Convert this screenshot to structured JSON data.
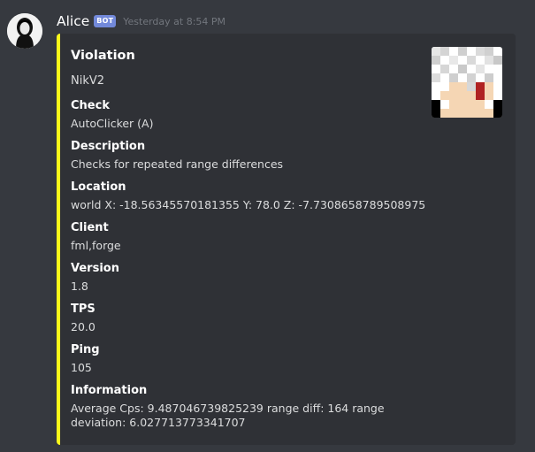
{
  "message": {
    "author": "Alice",
    "bot_tag": "BOT",
    "timestamp": "Yesterday at 8:54 PM",
    "avatar_icon": "user-avatar",
    "embed": {
      "accent_color": "#fbf81a",
      "title": "Violation",
      "description": "NikV2",
      "thumbnail_icon": "player-skin-head-thumbnail",
      "fields": [
        {
          "name": "Check",
          "value": "AutoClicker (A)"
        },
        {
          "name": "Description",
          "value": "Checks for repeated range differences"
        },
        {
          "name": "Location",
          "value": "world X: -18.56345570181355 Y: 78.0 Z: -7.7308658789508975"
        },
        {
          "name": "Client",
          "value": "fml,forge"
        },
        {
          "name": "Version",
          "value": "1.8"
        },
        {
          "name": "TPS",
          "value": "20.0"
        },
        {
          "name": "Ping",
          "value": "105"
        },
        {
          "name": "Information",
          "value": "Average Cps: 9.487046739825239 range diff: 164 range deviation: 6.027713773341707"
        }
      ]
    }
  }
}
